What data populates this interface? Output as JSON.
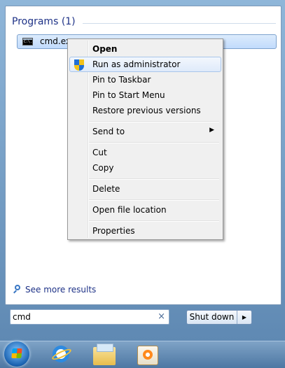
{
  "programs": {
    "header": "Programs (1)",
    "items": [
      {
        "label": "cmd.exe",
        "icon": "cmd-icon",
        "icon_text": "C:\\."
      }
    ]
  },
  "context_menu": {
    "items": [
      {
        "label": "Open",
        "default": true
      },
      {
        "label": "Run as administrator",
        "icon": "shield-icon",
        "highlighted": true
      },
      {
        "label": "Pin to Taskbar"
      },
      {
        "label": "Pin to Start Menu"
      },
      {
        "label": "Restore previous versions"
      },
      {
        "label": "Send to",
        "submenu": true,
        "submenu_arrow": "▶"
      },
      {
        "label": "Cut"
      },
      {
        "label": "Copy"
      },
      {
        "label": "Delete"
      },
      {
        "label": "Open file location"
      },
      {
        "label": "Properties"
      }
    ]
  },
  "see_more": {
    "label": "See more results",
    "icon": "search-icon"
  },
  "search": {
    "value": "cmd",
    "clear_glyph": "×"
  },
  "shutdown": {
    "label": "Shut down",
    "arrow": "▶"
  },
  "taskbar": {
    "items": [
      {
        "name": "start-orb",
        "icon": "windows-logo-icon"
      },
      {
        "name": "internet-explorer",
        "icon": "internet-explorer-icon"
      },
      {
        "name": "windows-explorer",
        "icon": "folder-icon"
      },
      {
        "name": "windows-media-player",
        "icon": "media-player-icon"
      }
    ]
  },
  "colors": {
    "header_text": "#1e3287",
    "menu_background": "#f0f0f0",
    "highlight_border": "#a9c6eb",
    "taskbar": "#4d77a3"
  }
}
